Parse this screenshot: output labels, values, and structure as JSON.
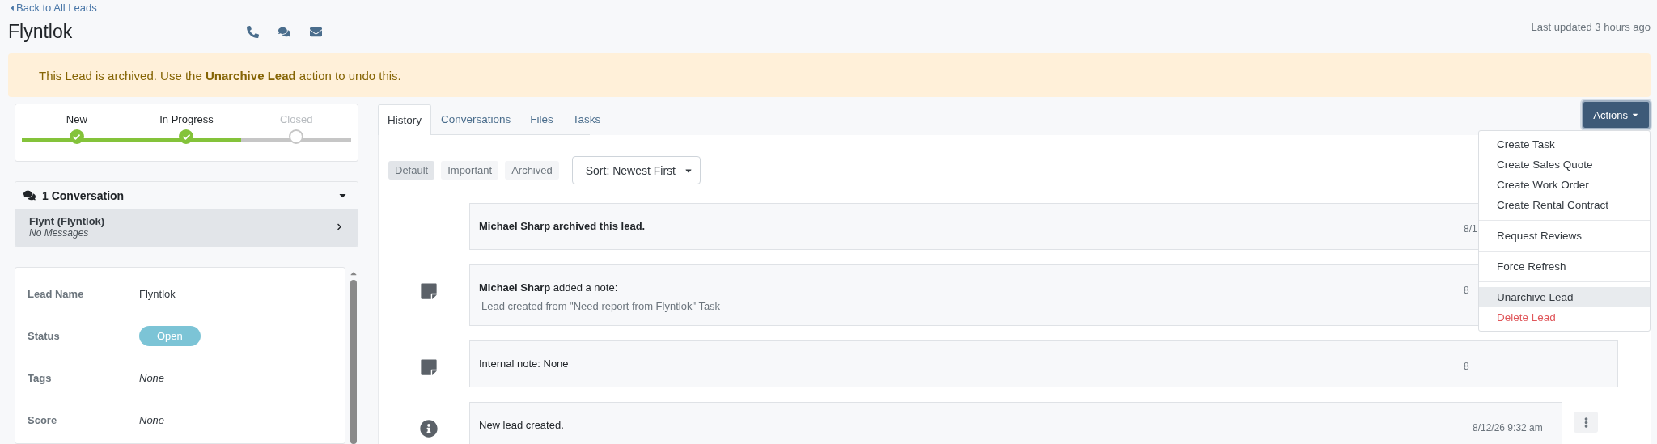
{
  "back_link": "Back to All Leads",
  "title": "Flyntlok",
  "last_updated": "Last updated 3 hours ago",
  "banner": "This Lead is archived. Use the **Unarchive Lead** action to undo this.",
  "progress": {
    "level": 0.667,
    "steps": [
      {
        "label": "New",
        "done": true
      },
      {
        "label": "In Progress",
        "done": true
      },
      {
        "label": "Closed",
        "done": false
      }
    ]
  },
  "conversations": {
    "title": "1 Conversation",
    "expanded": true,
    "items": [
      {
        "name": "Flynt (Flyntlok)",
        "subtitle": "No Messages",
        "selected": true
      }
    ]
  },
  "lead_info": {
    "fields": [
      {
        "label": "Lead Name",
        "value": "Flyntlok",
        "kind": "text"
      },
      {
        "label": "Status",
        "value": "Open",
        "kind": "badge"
      },
      {
        "label": "Tags",
        "value": "None",
        "kind": "empty"
      },
      {
        "label": "Score",
        "value": "None",
        "kind": "empty"
      }
    ]
  },
  "tabs": [
    {
      "label": "History",
      "selected": true
    },
    {
      "label": "Conversations",
      "selected": false
    },
    {
      "label": "Files",
      "selected": false
    },
    {
      "label": "Tasks",
      "selected": false
    }
  ],
  "filters": [
    {
      "label": "Default",
      "selected": true
    },
    {
      "label": "Important",
      "selected": false
    },
    {
      "label": "Archived",
      "selected": false
    }
  ],
  "sort": {
    "value": "Sort: Newest First"
  },
  "timeline": [
    {
      "kind": "archive",
      "text": "Michael Sharp archived this lead.",
      "timestamp": "8/1"
    },
    {
      "kind": "note",
      "text": "**Michael Sharp** added a note:",
      "detail": "Lead created from \"Need report from Flyntlok\" Task",
      "timestamp": "8"
    },
    {
      "kind": "note",
      "text": "Internal note: None",
      "timestamp": "8"
    },
    {
      "kind": "info",
      "text": "New lead created.",
      "timestamp": "8/12/26 9:32 am",
      "menu": true
    }
  ],
  "actions": {
    "label": "Actions",
    "expanded": true,
    "groups": [
      [
        {
          "label": "Create Task",
          "kind": "normal",
          "selected": false
        },
        {
          "label": "Create Sales Quote",
          "kind": "normal",
          "selected": false
        },
        {
          "label": "Create Work Order",
          "kind": "normal",
          "selected": false
        },
        {
          "label": "Create Rental Contract",
          "kind": "normal",
          "selected": false
        }
      ],
      [
        {
          "label": "Request Reviews",
          "kind": "normal",
          "selected": false
        }
      ],
      [
        {
          "label": "Force Refresh",
          "kind": "normal",
          "selected": false
        }
      ],
      [
        {
          "label": "Unarchive Lead",
          "kind": "normal",
          "selected": true
        },
        {
          "label": "Delete Lead",
          "kind": "danger",
          "selected": false
        }
      ]
    ]
  }
}
